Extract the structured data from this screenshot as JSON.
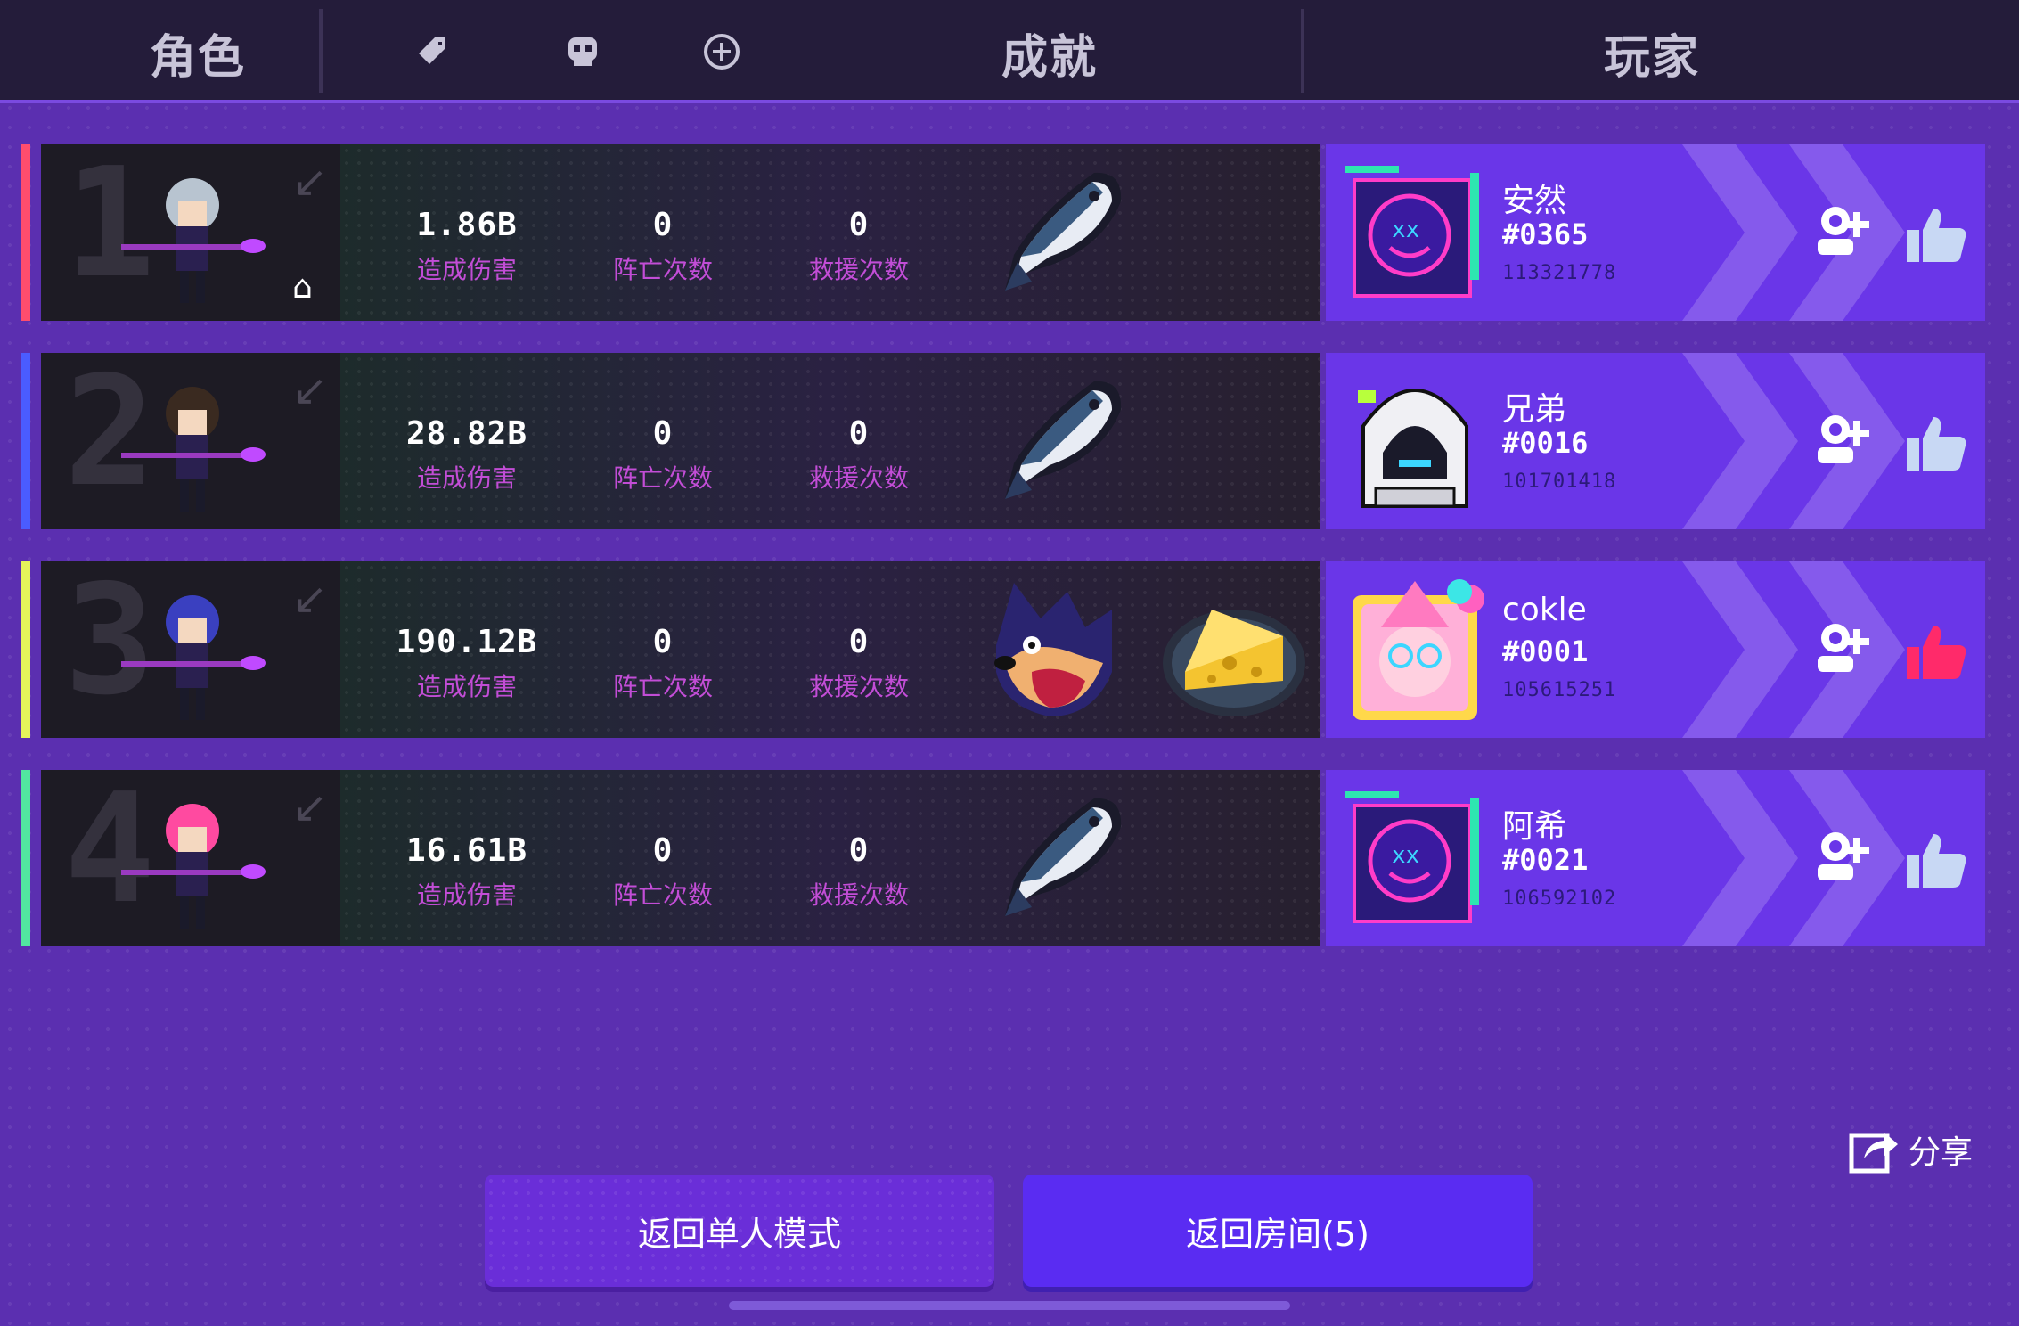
{
  "header": {
    "tab_character": "角色",
    "tab_achievement": "成就",
    "tab_player": "玩家",
    "icons": [
      "tag-icon",
      "skull-icon",
      "plus-circle-icon"
    ]
  },
  "rows": [
    {
      "rank": "1",
      "accent": "#ff4d6d",
      "damage": "1.86B",
      "damage_label": "造成伤害",
      "deaths": "0",
      "deaths_label": "阵亡次数",
      "rescues": "0",
      "rescues_label": "救援次数",
      "host": true,
      "achievements": [
        "fish"
      ],
      "player": {
        "name": "安然",
        "tag": "#0365",
        "id": "113321778",
        "avatar": "neon-abyss"
      }
    },
    {
      "rank": "2",
      "accent": "#4a5cff",
      "damage": "28.82B",
      "damage_label": "造成伤害",
      "deaths": "0",
      "deaths_label": "阵亡次数",
      "rescues": "0",
      "rescues_label": "救援次数",
      "host": false,
      "achievements": [
        "fish"
      ],
      "player": {
        "name": "兄弟",
        "tag": "#0016",
        "id": "101701418",
        "avatar": "hooded"
      }
    },
    {
      "rank": "3",
      "accent": "#e5f45a",
      "damage": "190.12B",
      "damage_label": "造成伤害",
      "deaths": "0",
      "deaths_label": "阵亡次数",
      "rescues": "0",
      "rescues_label": "救援次数",
      "host": false,
      "achievements": [
        "wolf",
        "cheese"
      ],
      "player": {
        "name": "cokle",
        "tag": "#0001",
        "id": "105615251",
        "avatar": "party"
      }
    },
    {
      "rank": "4",
      "accent": "#52e6a0",
      "damage": "16.61B",
      "damage_label": "造成伤害",
      "deaths": "0",
      "deaths_label": "阵亡次数",
      "rescues": "0",
      "rescues_label": "救援次数",
      "host": false,
      "achievements": [
        "fish"
      ],
      "player": {
        "name": "阿希",
        "tag": "#0021",
        "id": "106592102",
        "avatar": "neon-abyss"
      }
    }
  ],
  "share_label": "分享",
  "buttons": {
    "single": "返回单人模式",
    "room": "返回房间(5)"
  }
}
